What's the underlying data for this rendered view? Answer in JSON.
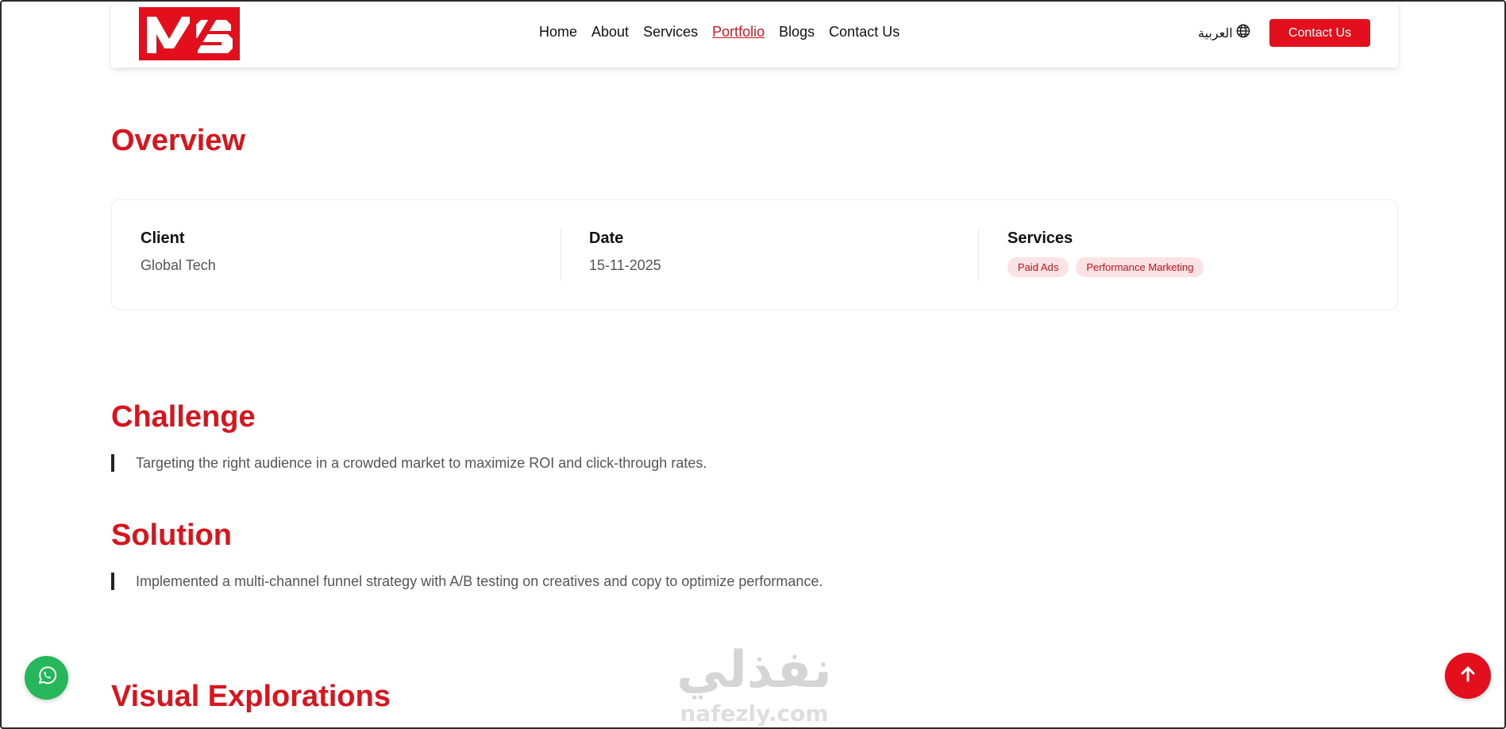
{
  "header": {
    "nav": [
      "Home",
      "About",
      "Services",
      "Portfolio",
      "Blogs",
      "Contact Us"
    ],
    "active_nav": "Portfolio",
    "language_label": "العربية",
    "cta_label": "Contact Us"
  },
  "overview": {
    "title": "Overview",
    "client_label": "Client",
    "client_value": "Global Tech",
    "date_label": "Date",
    "date_value": "15-11-2025",
    "services_label": "Services",
    "services_tags": [
      "Paid Ads",
      "Performance Marketing"
    ]
  },
  "challenge": {
    "title": "Challenge",
    "text": "Targeting the right audience in a crowded market to maximize ROI and click-through rates."
  },
  "solution": {
    "title": "Solution",
    "text": "Implemented a multi-channel funnel strategy with A/B testing on creatives and copy to optimize performance."
  },
  "visual": {
    "title": "Visual Explorations"
  },
  "watermark": {
    "arabic": "نفذلي",
    "latin": "nafezly.com"
  },
  "colors": {
    "brand_red": "#d9141c",
    "button_red": "#e30f1c",
    "tag_bg": "#fbe3e4",
    "whatsapp_green": "#25b75a"
  },
  "icons": {
    "language": "globe-icon",
    "whatsapp": "whatsapp-icon",
    "scroll_top": "arrow-up-icon"
  }
}
